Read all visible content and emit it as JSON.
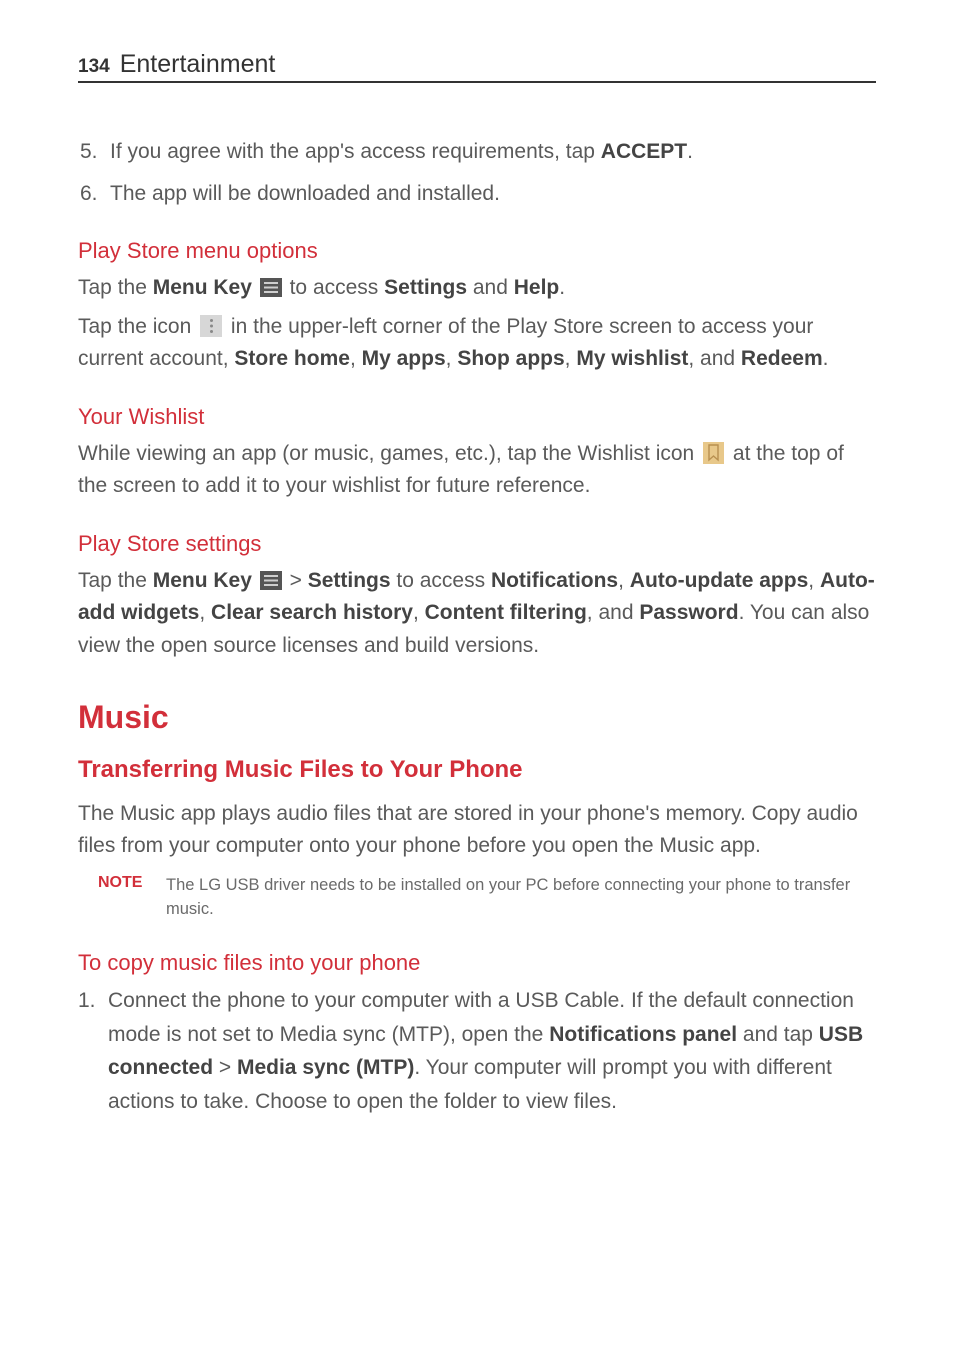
{
  "header": {
    "page_number": "134",
    "title": "Entertainment"
  },
  "step5": {
    "num": "5.",
    "t1": "If you agree with the app's access requirements, tap ",
    "accept": "ACCEPT",
    "t2": "."
  },
  "step6": {
    "num": "6.",
    "t1": "The app will be downloaded and installed."
  },
  "psmo": {
    "heading": "Play Store menu options",
    "l1a": "Tap the ",
    "l1b": "Menu Key ",
    "l1c": " to access ",
    "l1d": "Settings",
    "l1e": " and ",
    "l1f": "Help",
    "l1g": ".",
    "l2a": "Tap the icon ",
    "l2b": " in the upper-left corner of the Play Store screen to access your current account, ",
    "l2c": "Store home",
    "l2d": ", ",
    "l2e": "My apps",
    "l2f": ", ",
    "l2g": "Shop apps",
    "l2h": ", ",
    "l2i": "My wishlist",
    "l2j": ", and ",
    "l2k": "Redeem",
    "l2l": "."
  },
  "wishlist": {
    "heading": "Your Wishlist",
    "t1": "While viewing an app (or music, games, etc.), tap the Wishlist icon ",
    "t2": " at the top of the screen to add it to your wishlist for future reference."
  },
  "pss": {
    "heading": "Play Store settings",
    "t1": "Tap the ",
    "t2": "Menu Key ",
    "t3": " > ",
    "t4": "Settings",
    "t5": " to access ",
    "t6": "Notifications",
    "t7": ", ",
    "t8": "Auto-update apps",
    "t9": ", ",
    "t10": "Auto-add widgets",
    "t11": ", ",
    "t12": "Clear search history",
    "t13": ", ",
    "t14": "Content filtering",
    "t15": ", and ",
    "t16": "Password",
    "t17": ". You can also view the open source licenses and build versions."
  },
  "music": {
    "h1": "Music",
    "h2": "Transferring Music Files to Your Phone",
    "p1": "The Music app plays audio files that are stored in your phone's memory. Copy audio files from your computer onto your phone before you open the Music app.",
    "note_label": "NOTE",
    "note_body": "The LG USB driver needs to be installed on your PC before connecting your phone to transfer music."
  },
  "copy": {
    "heading": "To copy music files into your phone",
    "num": "1.",
    "t1": "Connect the phone to your computer with a USB Cable. If the default connection mode is not set to Media sync (MTP), open the ",
    "t2": "Notifications panel",
    "t3": " and tap ",
    "t4": "USB connected",
    "t5": " > ",
    "t6": "Media sync (MTP)",
    "t7": ". Your computer will prompt you with different actions to take. Choose to open the folder to view files."
  }
}
